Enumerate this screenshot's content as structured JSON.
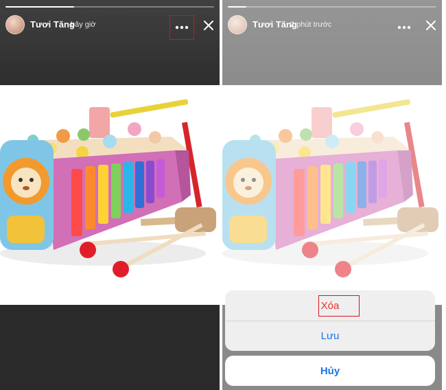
{
  "left_panel": {
    "user_name": "Tươi Tăng",
    "time": "bây giờ",
    "progress": 0.33
  },
  "right_panel": {
    "user_name": "Tươi Tăng",
    "time": "2 phút trước",
    "progress": 0.09,
    "action_sheet": {
      "delete_label": "Xóa",
      "save_label": "Lưu",
      "cancel_label": "Hủy"
    }
  },
  "icons": {
    "more": "more-horizontal-icon",
    "close": "close-icon"
  },
  "colors": {
    "highlight_box": "#d6131b",
    "delete_text": "#e5322e",
    "action_text": "#1a73e8"
  }
}
